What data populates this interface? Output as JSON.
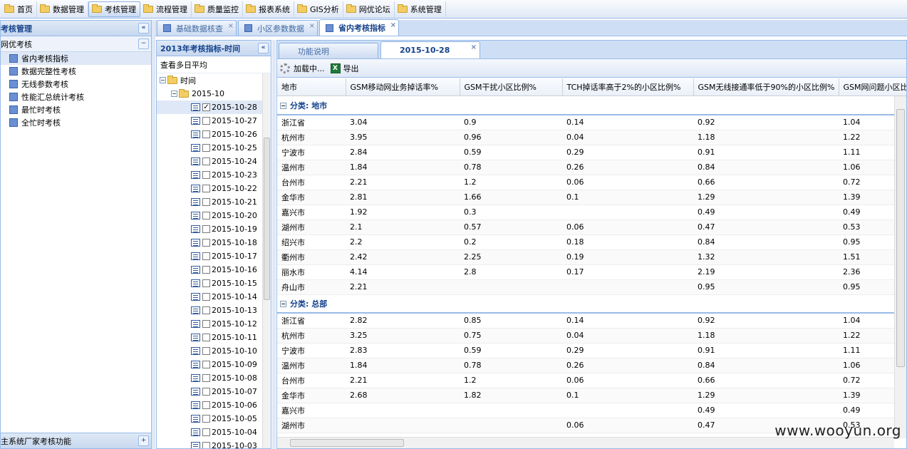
{
  "menu": [
    {
      "label": "首页",
      "active": false
    },
    {
      "label": "数据管理",
      "active": false
    },
    {
      "label": "考核管理",
      "active": true
    },
    {
      "label": "流程管理",
      "active": false
    },
    {
      "label": "质量监控",
      "active": false
    },
    {
      "label": "报表系统",
      "active": false
    },
    {
      "label": "GIS分析",
      "active": false
    },
    {
      "label": "网优论坛",
      "active": false
    },
    {
      "label": "系统管理",
      "active": false
    }
  ],
  "left": {
    "title": "考核管理",
    "collapse_icon": "«",
    "group": "网优考核",
    "group_toggle": "−",
    "items": [
      "省内考核指标",
      "数据完整性考核",
      "无线参数考核",
      "性能汇总统计考核",
      "最忙时考核",
      "全忙时考核"
    ],
    "footer": "主系统厂家考核功能",
    "footer_toggle": "+"
  },
  "tabs": [
    {
      "label": "基础数据核查",
      "active": false
    },
    {
      "label": "小区参数数据",
      "active": false
    },
    {
      "label": "省内考核指标",
      "active": true
    }
  ],
  "tree": {
    "title": "2013年考核指标-时间",
    "collapse_icon": "«",
    "avg_label": "查看多日平均",
    "root": "时间",
    "month": "2015-10",
    "dates": [
      "2015-10-28",
      "2015-10-27",
      "2015-10-26",
      "2015-10-25",
      "2015-10-24",
      "2015-10-23",
      "2015-10-22",
      "2015-10-21",
      "2015-10-20",
      "2015-10-19",
      "2015-10-18",
      "2015-10-17",
      "2015-10-16",
      "2015-10-15",
      "2015-10-14",
      "2015-10-13",
      "2015-10-12",
      "2015-10-11",
      "2015-10-10",
      "2015-10-09",
      "2015-10-08",
      "2015-10-07",
      "2015-10-06",
      "2015-10-05",
      "2015-10-04",
      "2015-10-03"
    ],
    "checked": "2015-10-28"
  },
  "subtabs": [
    {
      "label": "功能说明",
      "active": false
    },
    {
      "label": "2015-10-28",
      "active": true
    }
  ],
  "toolbar": {
    "loading": "加载中...",
    "export": "导出"
  },
  "grid": {
    "columns": [
      "地市",
      "GSM移动网业务掉话率%",
      "GSM干扰小区比例%",
      "TCH掉话率高于2%的小区比例%",
      "GSM无线接通率低于90%的小区比例%",
      "GSM网问题小区比例%"
    ],
    "groups": [
      {
        "label": "分类: 地市",
        "rows": [
          [
            "浙江省",
            "3.04",
            "0.9",
            "0.14",
            "0.92",
            "1.04"
          ],
          [
            "杭州市",
            "3.95",
            "0.96",
            "0.04",
            "1.18",
            "1.22"
          ],
          [
            "宁波市",
            "2.84",
            "0.59",
            "0.29",
            "0.91",
            "1.11"
          ],
          [
            "温州市",
            "1.84",
            "0.78",
            "0.26",
            "0.84",
            "1.06"
          ],
          [
            "台州市",
            "2.21",
            "1.2",
            "0.06",
            "0.66",
            "0.72"
          ],
          [
            "金华市",
            "2.81",
            "1.66",
            "0.1",
            "1.29",
            "1.39"
          ],
          [
            "嘉兴市",
            "1.92",
            "0.3",
            "",
            "0.49",
            "0.49"
          ],
          [
            "湖州市",
            "2.1",
            "0.57",
            "0.06",
            "0.47",
            "0.53"
          ],
          [
            "绍兴市",
            "2.2",
            "0.2",
            "0.18",
            "0.84",
            "0.95"
          ],
          [
            "衢州市",
            "2.42",
            "2.25",
            "0.19",
            "1.32",
            "1.51"
          ],
          [
            "丽水市",
            "4.14",
            "2.8",
            "0.17",
            "2.19",
            "2.36"
          ],
          [
            "舟山市",
            "2.21",
            "",
            "",
            "0.95",
            "0.95"
          ]
        ]
      },
      {
        "label": "分类: 总部",
        "rows": [
          [
            "浙江省",
            "2.82",
            "0.85",
            "0.14",
            "0.92",
            "1.04"
          ],
          [
            "杭州市",
            "3.25",
            "0.75",
            "0.04",
            "1.18",
            "1.22"
          ],
          [
            "宁波市",
            "2.83",
            "0.59",
            "0.29",
            "0.91",
            "1.11"
          ],
          [
            "温州市",
            "1.84",
            "0.78",
            "0.26",
            "0.84",
            "1.06"
          ],
          [
            "台州市",
            "2.21",
            "1.2",
            "0.06",
            "0.66",
            "0.72"
          ],
          [
            "金华市",
            "2.68",
            "1.82",
            "0.1",
            "1.29",
            "1.39"
          ],
          [
            "嘉兴市",
            "",
            "",
            "",
            "0.49",
            "0.49"
          ],
          [
            "湖州市",
            "",
            "",
            "0.06",
            "0.47",
            "0.53"
          ]
        ]
      }
    ]
  },
  "watermark": "www.wooyun.org"
}
